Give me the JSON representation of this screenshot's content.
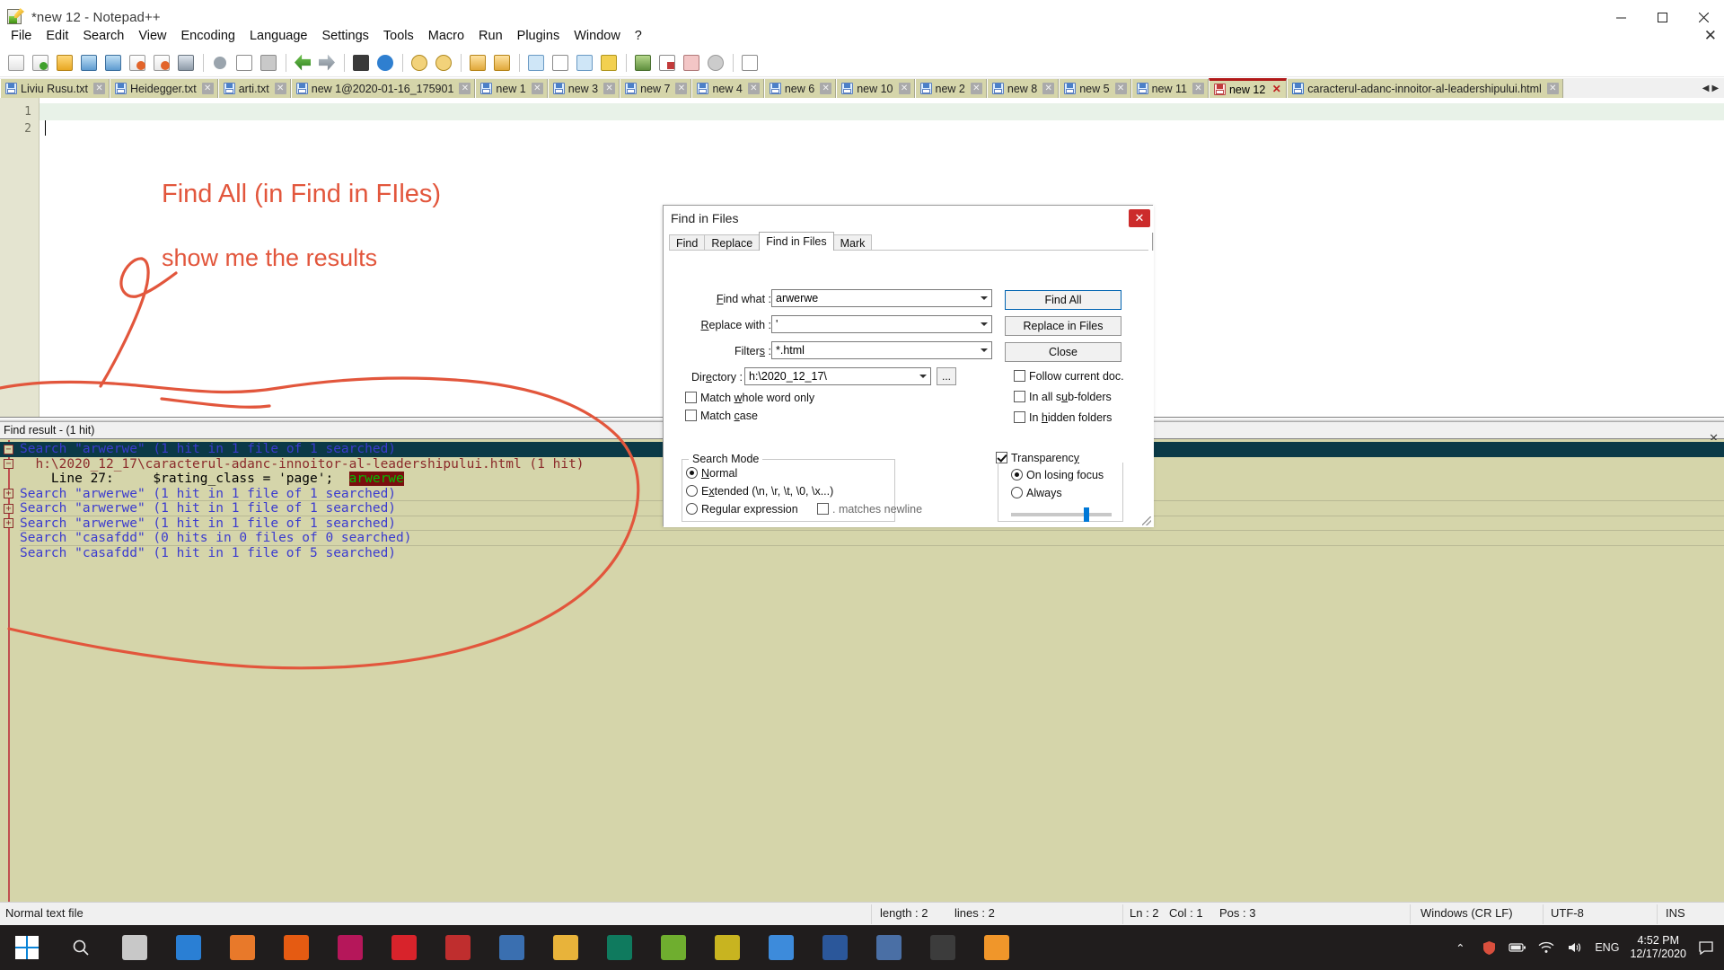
{
  "window": {
    "title": "*new 12 - Notepad++",
    "app_icon": "notepad-plus-plus-icon",
    "minimize": "—",
    "maximize": "❐",
    "close": "✕"
  },
  "menu": {
    "items": [
      "File",
      "Edit",
      "Search",
      "View",
      "Encoding",
      "Language",
      "Settings",
      "Tools",
      "Macro",
      "Run",
      "Plugins",
      "Window",
      "?"
    ],
    "close_document": "✕"
  },
  "tabs": {
    "items": [
      {
        "label": "Liviu Rusu.txt",
        "active": false,
        "kind": "txt"
      },
      {
        "label": "Heidegger.txt",
        "active": false,
        "kind": "txt"
      },
      {
        "label": "arti.txt",
        "active": false,
        "kind": "txt"
      },
      {
        "label": "new 1@2020-01-16_175901",
        "active": false,
        "kind": "txt"
      },
      {
        "label": "new 1",
        "active": false,
        "kind": "txt"
      },
      {
        "label": "new 3",
        "active": false,
        "kind": "txt"
      },
      {
        "label": "new 7",
        "active": false,
        "kind": "txt"
      },
      {
        "label": "new 4",
        "active": false,
        "kind": "txt"
      },
      {
        "label": "new 6",
        "active": false,
        "kind": "txt"
      },
      {
        "label": "new 10",
        "active": false,
        "kind": "txt"
      },
      {
        "label": "new 2",
        "active": false,
        "kind": "txt"
      },
      {
        "label": "new 8",
        "active": false,
        "kind": "txt"
      },
      {
        "label": "new 5",
        "active": false,
        "kind": "txt"
      },
      {
        "label": "new 11",
        "active": false,
        "kind": "txt"
      },
      {
        "label": "new 12",
        "active": true,
        "kind": "modified"
      },
      {
        "label": "caracterul-adanc-innoitor-al-leadershipului.html",
        "active": false,
        "kind": "html"
      }
    ],
    "close_glyph": "✕",
    "nav_left": "◀",
    "nav_right": "▶"
  },
  "editor": {
    "line_numbers": [
      "1",
      "2"
    ]
  },
  "annotations": {
    "note_1": "Find All (in Find in FIles)",
    "note_2": "show me the results",
    "pen_color": "#e2563c"
  },
  "find_result": {
    "panel_title": "Find result - (1 hit)",
    "close_glyph": "✕",
    "rows": [
      {
        "fold": "minus",
        "selected": true,
        "segments": [
          {
            "text": "Search ",
            "color": "blue"
          },
          {
            "text": "\"arwerwe\"",
            "color": "blue"
          },
          {
            "text": " (1 hit in 1 file of 1 searched)",
            "color": "blue"
          }
        ]
      },
      {
        "fold": "minus",
        "selected": false,
        "segments": [
          {
            "text": "  h:\\2020_12_17\\caracterul-adanc-innoitor-al-leadershipului.html (1 hit)",
            "color": "darkred"
          }
        ]
      },
      {
        "fold": "end",
        "selected": false,
        "segments": [
          {
            "text": "    Line 27:     $rating_class = 'page';  ",
            "color": "black"
          },
          {
            "text": "arwerwe",
            "color": "hit"
          }
        ]
      },
      {
        "fold": "plus",
        "selected": false,
        "segments": [
          {
            "text": "Search \"arwerwe\" (1 hit in 1 file of 1 searched)",
            "color": "blue"
          }
        ]
      },
      {
        "fold": "plus",
        "selected": false,
        "segments": [
          {
            "text": "Search \"arwerwe\" (1 hit in 1 file of 1 searched)",
            "color": "blue"
          }
        ]
      },
      {
        "fold": "plus",
        "selected": false,
        "segments": [
          {
            "text": "Search \"arwerwe\" (1 hit in 1 file of 1 searched)",
            "color": "blue"
          }
        ]
      },
      {
        "fold": "none",
        "selected": false,
        "segments": [
          {
            "text": "Search \"casafdd\" (0 hits in 0 files of 0 searched)",
            "color": "blue"
          }
        ]
      },
      {
        "fold": "none",
        "selected": false,
        "segments": [
          {
            "text": "Search \"casafdd\" (1 hit in 1 file of 5 searched)",
            "color": "blue"
          }
        ]
      }
    ]
  },
  "dialog": {
    "title": "Find in Files",
    "close_glyph": "✕",
    "tabs": [
      {
        "label": "Find",
        "active": false
      },
      {
        "label": "Replace",
        "active": false
      },
      {
        "label": "Find in Files",
        "active": true
      },
      {
        "label": "Mark",
        "active": false
      }
    ],
    "fields": [
      {
        "label": "Find what :",
        "value": "arwerwe",
        "accel": "F"
      },
      {
        "label": "Replace with :",
        "value": "'",
        "accel": "R"
      },
      {
        "label": "Filters :",
        "value": "*.html",
        "accel": "s"
      },
      {
        "label": "Directory :",
        "value": "h:\\2020_12_17\\",
        "accel": "e"
      }
    ],
    "browse_button": "...",
    "buttons": [
      {
        "label": "Find All",
        "primary": true
      },
      {
        "label": "Replace in Files",
        "primary": false
      },
      {
        "label": "Close",
        "primary": false
      }
    ],
    "checkboxes_left": [
      {
        "label": "Match whole word only",
        "checked": false
      },
      {
        "label": "Match case",
        "checked": false
      }
    ],
    "checkboxes_right": [
      {
        "label": "Follow current doc.",
        "checked": false
      },
      {
        "label": "In all sub-folders",
        "checked": false
      },
      {
        "label": "In hidden folders",
        "checked": false
      }
    ],
    "search_mode": {
      "caption": "Search Mode",
      "options": [
        {
          "label": "Normal",
          "selected": true
        },
        {
          "label": "Extended (\\n, \\r, \\t, \\0, \\x...)",
          "selected": false
        },
        {
          "label": "Regular expression",
          "selected": false
        }
      ],
      "matches_newline": {
        "label": ". matches newline",
        "checked": false
      }
    },
    "transparency": {
      "caption": "Transparency",
      "checked": true,
      "options": [
        {
          "label": "On losing focus",
          "selected": true
        },
        {
          "label": "Always",
          "selected": false
        }
      ],
      "slider_percent": 72
    }
  },
  "statusbar": {
    "file_type": "Normal text file",
    "length": "length : 2",
    "lines": "lines : 2",
    "ln": "Ln : 2",
    "col": "Col : 1",
    "pos": "Pos : 3",
    "eol": "Windows (CR LF)",
    "encoding": "UTF-8",
    "insert_mode": "INS"
  },
  "taskbar": {
    "start": "start-button",
    "search": "search-icon",
    "items": [
      {
        "name": "store-icon",
        "color": "#c8c8c8"
      },
      {
        "name": "edge-icon",
        "color": "#2a7fd4"
      },
      {
        "name": "media-icon",
        "color": "#e8792a"
      },
      {
        "name": "firefox-icon",
        "color": "#e55b12"
      },
      {
        "name": "opera-gx-icon",
        "color": "#b5175a"
      },
      {
        "name": "opera-icon",
        "color": "#d8232b"
      },
      {
        "name": "filezilla-icon",
        "color": "#bf2e2e"
      },
      {
        "name": "notepad-icon",
        "color": "#3a6fb0"
      },
      {
        "name": "explorer-icon",
        "color": "#e8b33a"
      },
      {
        "name": "dreamweaver-icon",
        "color": "#0f7a5e"
      },
      {
        "name": "notepad-plus-plus-icon",
        "color": "#6fae2f"
      },
      {
        "name": "flash-icon",
        "color": "#c8b420"
      },
      {
        "name": "chrome-icon",
        "color": "#3d8bdb"
      },
      {
        "name": "word-icon",
        "color": "#2b579a"
      },
      {
        "name": "stats-icon",
        "color": "#4a6fa5"
      },
      {
        "name": "ultra-icon",
        "color": "#3c3c3c"
      },
      {
        "name": "puzzle-icon",
        "color": "#f0962a"
      }
    ],
    "tray": {
      "chevron": "⌃",
      "shield": "shield-icon",
      "battery": "battery-icon",
      "wifi": "wifi-icon",
      "volume": "volume-icon",
      "language": "ENG",
      "time": "4:52 PM",
      "date": "12/17/2020",
      "notifications": "notifications-icon"
    }
  }
}
